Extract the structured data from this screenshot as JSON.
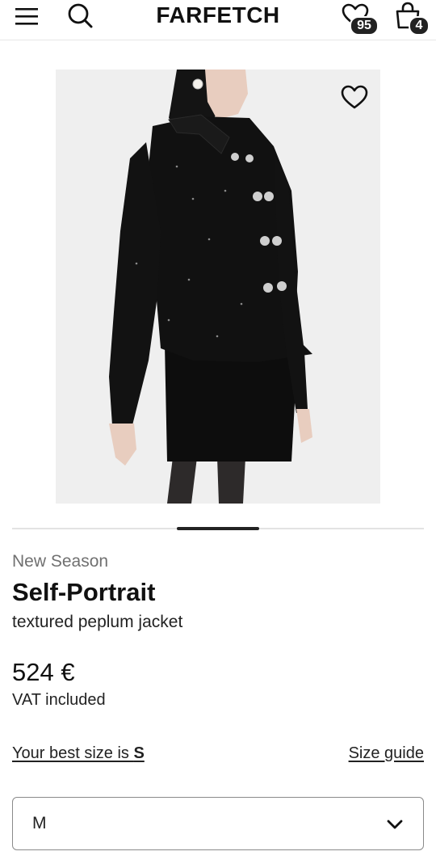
{
  "header": {
    "logo": "FARFETCH",
    "wishlist_count": "95",
    "bag_count": "4",
    "icons": [
      "menu-icon",
      "search-icon",
      "wishlist-icon",
      "bag-icon"
    ]
  },
  "product": {
    "image_alt": "Self-Portrait textured peplum jacket",
    "label": "New Season",
    "brand": "Self-Portrait",
    "description": "textured peplum jacket",
    "price": "524 €",
    "vat": "VAT included"
  },
  "carousel": {
    "active_index": 2,
    "total": 5
  },
  "size": {
    "best_size_text": "Your best size is ",
    "best_size_value": "S",
    "size_guide_label": "Size guide",
    "selected": "M"
  },
  "colors": {
    "text": "#222222",
    "muted": "#707070",
    "image_bg": "#efefef",
    "badge": "#222222"
  }
}
